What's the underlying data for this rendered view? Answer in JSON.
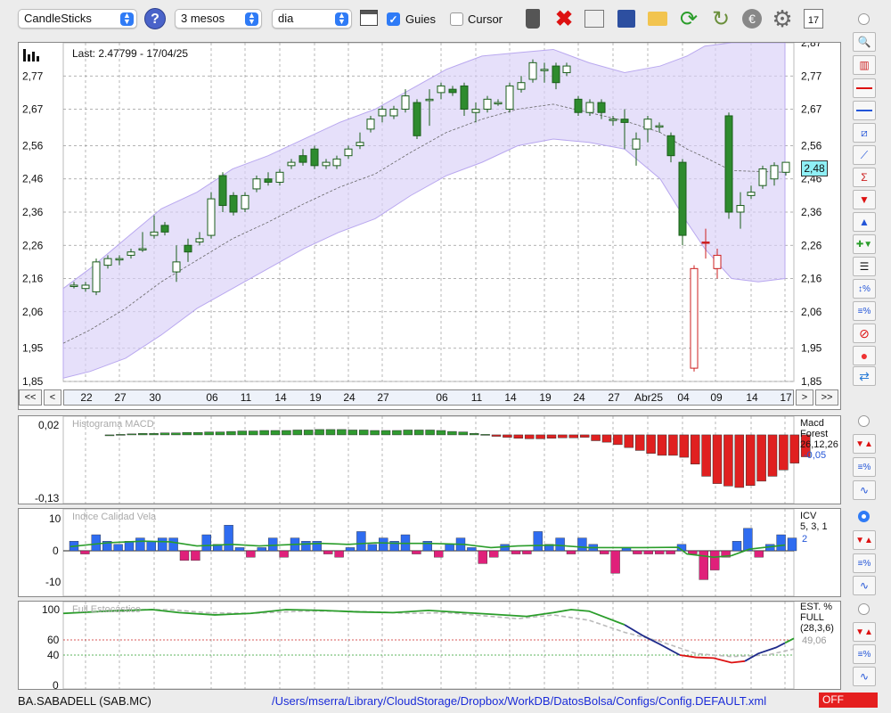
{
  "toolbar": {
    "chart_type": "CandleSticks",
    "period": "3 mesos",
    "interval": "dia",
    "guides_label": "Guies",
    "cursor_label": "Cursor"
  },
  "main": {
    "last_label": "Last: 2.47799 - 17/04/25",
    "price_badge": "2,48",
    "y_ticks_left": [
      "2,77",
      "2,67",
      "2,56",
      "2,46",
      "2,36",
      "2,26",
      "2,16",
      "2,06",
      "1,95",
      "1,85"
    ],
    "y_ticks_right": [
      "2,87",
      "2,77",
      "2,67",
      "2,56",
      "2,46",
      "2,36",
      "2,26",
      "2,16",
      "2,06",
      "1,95",
      "1,85"
    ],
    "x_labels": [
      "22",
      "27",
      "30",
      "06",
      "11",
      "14",
      "19",
      "24",
      "27",
      "06",
      "11",
      "14",
      "19",
      "24",
      "27",
      "Abr25",
      "04",
      "09",
      "14",
      "17"
    ],
    "nav_first": "<<",
    "nav_prev": "<",
    "nav_next": ">",
    "nav_last": ">>"
  },
  "macd": {
    "title": "Histograma MACD",
    "y_top": "0,02",
    "y_bottom": "-0,13",
    "label_line1": "Macd",
    "label_line2": "Forest",
    "label_line3": "26,12,26",
    "value": "-0,05"
  },
  "icv": {
    "title": "Indice Calidad Vela",
    "y_top": "10",
    "y_mid": "0",
    "y_bottom": "-10",
    "label_line1": "ICV",
    "label_line2": "5, 3, 1",
    "value": "2"
  },
  "est": {
    "title": "Full Estocástico",
    "y_ticks": [
      "100",
      "60",
      "40",
      "0"
    ],
    "label_line1": "EST. %",
    "label_line2": "FULL",
    "label_line3": "(28,3,6)",
    "value": "49,06"
  },
  "status": {
    "ticker": "BA.SABADELL (SAB.MC)",
    "path": "/Users/mserra/Library/CloudStorage/Dropbox/WorkDB/DatosBolsa/Configs/Config.DEFAULT.xml",
    "flag": "OFF"
  },
  "colors": {
    "up": "#2e8b2e",
    "down": "#cc1f1f",
    "band": "#d9cff7",
    "macd_up": "#2f9a2f",
    "macd_down": "#e02020",
    "icv_up": "#2f6cf0",
    "icv_down": "#e0207a"
  }
}
